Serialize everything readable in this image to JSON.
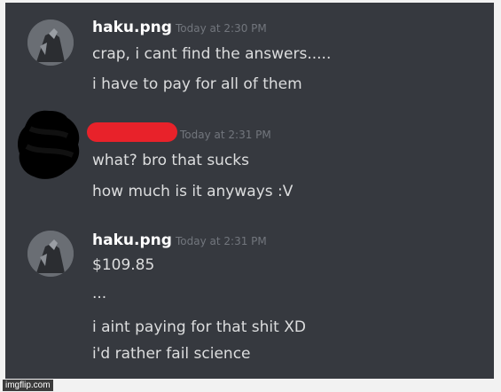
{
  "messages": [
    {
      "username": "haku.png",
      "timestamp": "Today at 2:30 PM",
      "lines": [
        "crap, i cant find the answers.....",
        "i have to pay for all of them"
      ]
    },
    {
      "username": "",
      "timestamp": "Today at 2:31 PM",
      "lines": [
        "what? bro that sucks",
        "how much is it anyways :V"
      ]
    },
    {
      "username": "haku.png",
      "timestamp": "Today at 2:31 PM",
      "lines": [
        "$109.85",
        "...",
        "i aint paying for that shit XD",
        "i'd rather fail science"
      ]
    }
  ],
  "watermark": "imgflip.com",
  "colors": {
    "background": "#36393f",
    "username": "#ffffff",
    "message_text": "#dcddde",
    "timestamp": "#72767d",
    "redaction": "#e8222a",
    "scribble": "#000000"
  }
}
